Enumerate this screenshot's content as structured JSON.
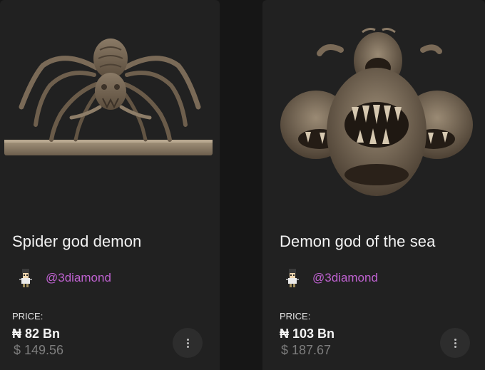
{
  "cards": [
    {
      "title": "Spider god demon",
      "image_subject": "spider god demon sculpture",
      "creator_handle": "@3diamond",
      "price_label": "PRICE:",
      "price_main": "₦ 82 Bn",
      "price_usd": "$ 149.56",
      "menu_icon": "more-vertical-icon"
    },
    {
      "title": "Demon god of the sea",
      "image_subject": "multi-headed sea demon sculpture",
      "creator_handle": "@3diamond",
      "price_label": "PRICE:",
      "price_main": "₦ 103 Bn",
      "price_usd": "$ 187.67",
      "menu_icon": "more-vertical-icon"
    }
  ],
  "colors": {
    "background": "#161616",
    "card": "#212121",
    "title": "#f2f2f2",
    "handle": "#c062d2",
    "usd_price": "#7d7d7d",
    "menu_button": "#2d2d2d"
  }
}
